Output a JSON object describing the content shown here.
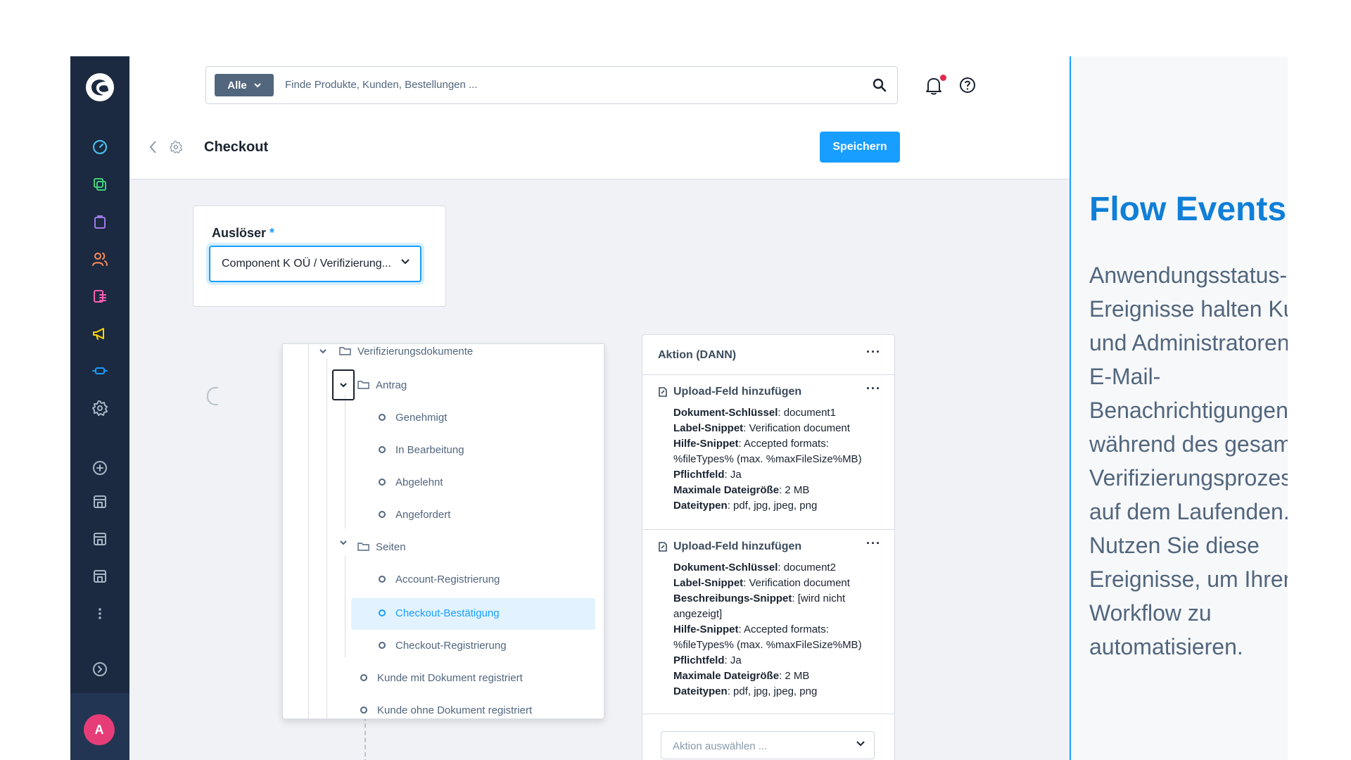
{
  "colors": {
    "accent": "#189eff",
    "sidebar": "#1b2a40",
    "highlight_title": "#0f7fd8",
    "notification": "#de294c"
  },
  "sidebar": {
    "icons": [
      "dashboard-icon",
      "catalog-icon",
      "orders-icon",
      "customers-icon",
      "content-icon",
      "marketing-icon",
      "extensions-icon",
      "settings-icon",
      "add-sales-channel-icon",
      "storefront-icon",
      "headless-icon",
      "headless-2-icon",
      "more-icon",
      "expand-icon"
    ],
    "avatar": "A"
  },
  "search": {
    "filter": "Alle",
    "placeholder": "Finde Produkte, Kunden, Bestellungen ..."
  },
  "header": {
    "title": "Checkout",
    "save_label": "Speichern"
  },
  "trigger": {
    "label": "Auslöser",
    "required_mark": "*",
    "value": "Component K OÜ / Verifizierung..."
  },
  "tree": {
    "root": "Verifizierungsdokumente",
    "group1": "Antrag",
    "group1_items": [
      "Genehmigt",
      "In Bearbeitung",
      "Abgelehnt",
      "Angefordert"
    ],
    "group2": "Seiten",
    "group2_items": [
      "Account-Registrierung",
      "Checkout-Bestätigung",
      "Checkout-Registrierung"
    ],
    "root_items": [
      "Kunde mit Dokument registriert",
      "Kunde ohne Dokument registriert"
    ],
    "selected": "Checkout-Bestätigung"
  },
  "action": {
    "title": "Aktion (DANN)",
    "blocks": [
      {
        "title": "Upload-Feld hinzufügen",
        "lines": [
          {
            "k": "Dokument-Schlüssel",
            "v": ": document1"
          },
          {
            "k": "Label-Snippet",
            "v": ": Verification document"
          },
          {
            "k": "Hilfe-Snippet",
            "v": ": Accepted formats: %fileTypes% (max. %maxFileSize%MB)"
          },
          {
            "k": "Pflichtfeld",
            "v": ": Ja"
          },
          {
            "k": "Maximale Dateigröße",
            "v": ": 2 MB"
          },
          {
            "k": "Dateitypen",
            "v": ": pdf, jpg, jpeg, png"
          }
        ]
      },
      {
        "title": "Upload-Feld hinzufügen",
        "lines": [
          {
            "k": "Dokument-Schlüssel",
            "v": ": document2"
          },
          {
            "k": "Label-Snippet",
            "v": ": Verification document"
          },
          {
            "k": "Beschreibungs-Snippet",
            "v": ": [wird nicht angezeigt]"
          },
          {
            "k": "Hilfe-Snippet",
            "v": ": Accepted formats: %fileTypes% (max. %maxFileSize%MB)"
          },
          {
            "k": "Pflichtfeld",
            "v": ": Ja"
          },
          {
            "k": "Maximale Dateigröße",
            "v": ": 2 MB"
          },
          {
            "k": "Dateitypen",
            "v": ": pdf, jpg, jpeg, png"
          }
        ]
      }
    ],
    "select_placeholder": "Aktion auswählen ..."
  },
  "panel": {
    "title": "Flow Events",
    "text": "Anwendungsstatus-Ereignisse halten Kunden und Administratoren durch E-Mail-Benachrichtigungen während des gesamten Verifizierungsprozesses auf dem Laufenden. Nutzen Sie diese Ereignisse, um Ihren Workflow zu automatisieren."
  }
}
